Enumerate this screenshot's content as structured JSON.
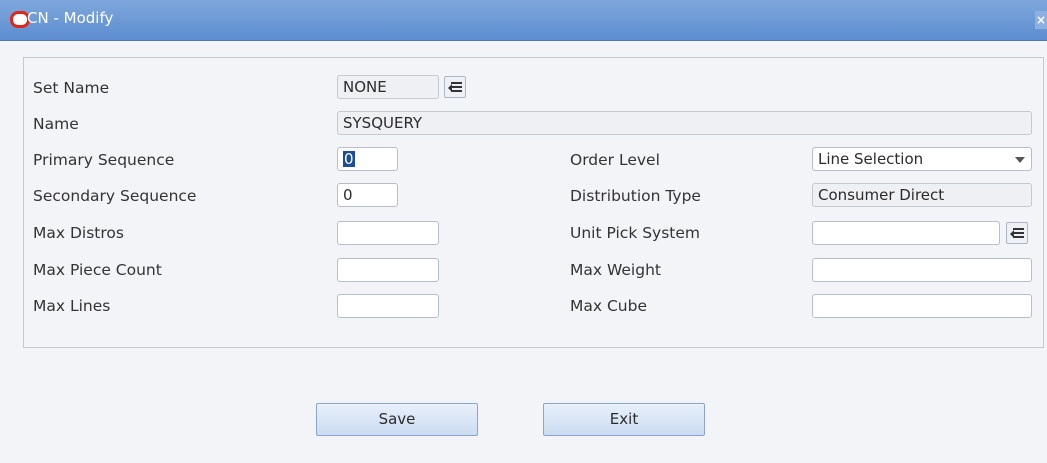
{
  "window": {
    "title": "CN - Modify",
    "close_icon": "close-icon"
  },
  "form": {
    "set_name": {
      "label": "Set Name",
      "value": "NONE"
    },
    "name": {
      "label": "Name",
      "value": "SYSQUERY"
    },
    "primary_sequence": {
      "label": "Primary Sequence",
      "value": "0"
    },
    "secondary_sequence": {
      "label": "Secondary Sequence",
      "value": "0"
    },
    "max_distros": {
      "label": "Max Distros",
      "value": ""
    },
    "max_piece_count": {
      "label": "Max Piece Count",
      "value": ""
    },
    "max_lines": {
      "label": "Max Lines",
      "value": ""
    },
    "order_level": {
      "label": "Order Level",
      "value": "Line Selection"
    },
    "distribution_type": {
      "label": "Distribution Type",
      "value": "Consumer Direct"
    },
    "unit_pick_system": {
      "label": "Unit Pick System",
      "value": ""
    },
    "max_weight": {
      "label": "Max Weight",
      "value": ""
    },
    "max_cube": {
      "label": "Max Cube",
      "value": ""
    }
  },
  "buttons": {
    "save": "Save",
    "exit": "Exit"
  },
  "colors": {
    "titlebar": "#6a97d6",
    "background": "#f2f4f7",
    "logo": "#e0261b"
  }
}
